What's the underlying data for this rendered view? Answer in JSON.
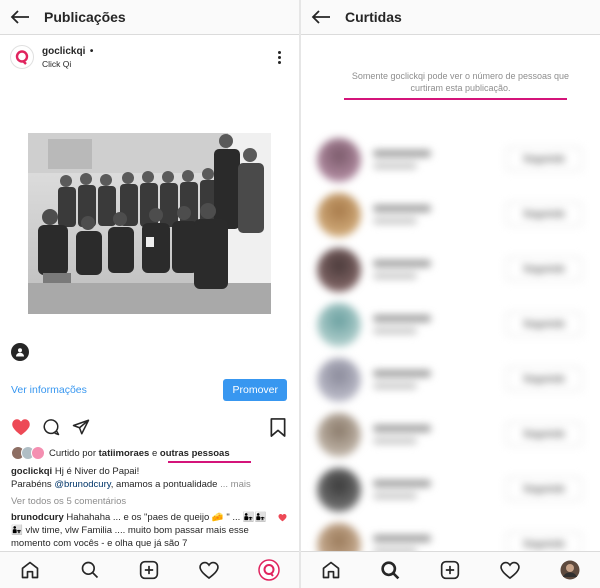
{
  "left": {
    "title": "Publicações",
    "post": {
      "username": "goclickqi",
      "dot": "•",
      "location": "Click Qi",
      "insights_label": "Ver informações",
      "promote_label": "Promover"
    },
    "likes": {
      "prefix": "Curtido por",
      "user": "tatiimoraes",
      "connector": "e",
      "others": "outras pessoas"
    },
    "caption": {
      "author": "goclickqi",
      "line1": "Hj é Niver do Papai!",
      "line2_start": "Parabéns",
      "mention": "@brunodcury",
      "line2_end": ", amamos a pontualidade",
      "more": "... mais"
    },
    "comments_link": "Ver todos os 5 comentários",
    "comment": {
      "author": "brunodcury",
      "text": "Hahahaha ... e os \"paes de queijo 🧀 \" ... 👨‍👧👨‍👧👨‍👧 vlw time, vlw Familia .... muito bom passar mais esse momento com vocês - e olha que já são 7"
    }
  },
  "right": {
    "title": "Curtidas",
    "notice": "Somente goclickqi pode ver o número de pessoas que curtiram esta publicação.",
    "follow_label": "Seguindo"
  },
  "colors": {
    "accent_blue": "#3897f0",
    "highlight_pink": "#d4147a",
    "like_red": "#ed4956"
  },
  "icons": {
    "left_nav": [
      "home-icon",
      "search-icon",
      "add-icon",
      "heart-icon",
      "profile-icon"
    ],
    "right_nav": [
      "home-icon",
      "search-icon",
      "add-icon",
      "heart-icon",
      "profile-icon"
    ]
  }
}
